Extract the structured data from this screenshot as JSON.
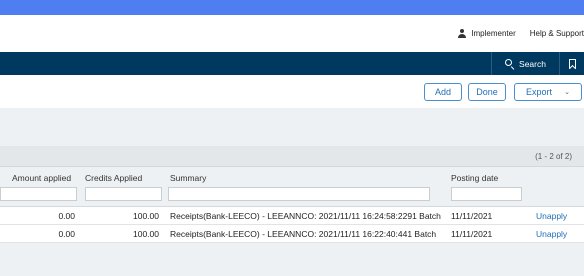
{
  "header": {
    "user_label": "Implementer",
    "help_label": "Help & Support"
  },
  "nav": {
    "search_label": "Search"
  },
  "toolbar": {
    "add_label": "Add",
    "done_label": "Done",
    "export_label": "Export"
  },
  "grid": {
    "count_text": "(1 - 2 of 2)",
    "columns": {
      "amount_applied": "Amount applied",
      "credits_applied": "Credits Applied",
      "summary": "Summary",
      "posting_date": "Posting date"
    },
    "rows": [
      {
        "amount_applied": "0.00",
        "credits_applied": "100.00",
        "summary": "Receipts(Bank-LEECO) - LEEANNCO: 2021/11/11 16:24:58:2291 Batch",
        "posting_date": "11/11/2021",
        "action": "Unapply"
      },
      {
        "amount_applied": "0.00",
        "credits_applied": "100.00",
        "summary": "Receipts(Bank-LEECO) - LEEANNCO: 2021/11/11 16:22:40:441 Batch",
        "posting_date": "11/11/2021",
        "action": "Unapply"
      }
    ]
  },
  "colors": {
    "top_band": "#4f7ef0",
    "nav_bar": "#00395f",
    "link": "#1f6fb7"
  }
}
